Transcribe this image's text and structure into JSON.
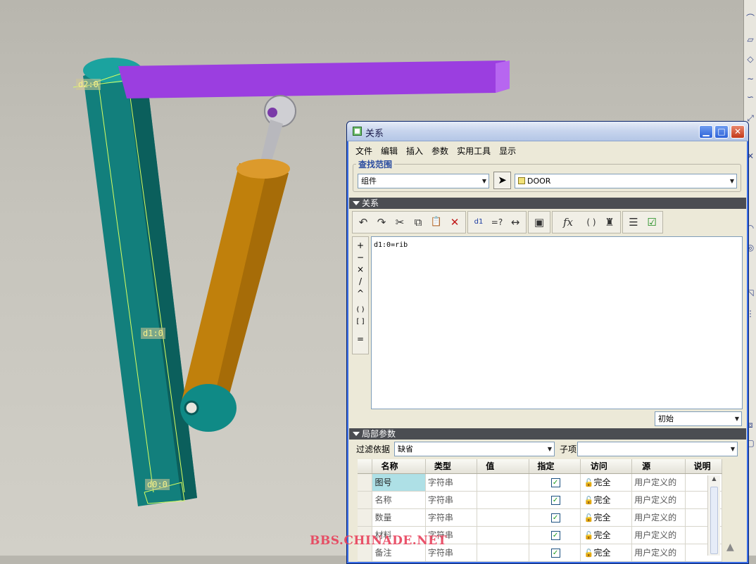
{
  "viewport": {
    "dim_top": "d2:0",
    "dim_mid": "d1:0",
    "dim_bottom": "d0:0"
  },
  "dialog": {
    "title": "关系",
    "window_buttons": {
      "minimize": "▁",
      "maximize": "□",
      "close": "✕"
    },
    "menu": [
      "文件",
      "编辑",
      "插入",
      "参数",
      "实用工具",
      "显示"
    ],
    "scope": {
      "legend": "查找范围",
      "type_value": "组件",
      "model_value": "DOOR"
    },
    "relations": {
      "header": "关系",
      "toolbar": [
        {
          "icon": "undo-icon",
          "glyph": "↶"
        },
        {
          "icon": "redo-icon",
          "glyph": "↷"
        },
        {
          "icon": "cut-icon",
          "glyph": "✂"
        },
        {
          "icon": "copy-icon",
          "glyph": "⧉"
        },
        {
          "icon": "paste-icon",
          "glyph": "📋"
        },
        {
          "icon": "delete-icon",
          "glyph": "✕"
        },
        {
          "icon": "show-values-icon",
          "glyph": "d1"
        },
        {
          "icon": "evaluate-icon",
          "glyph": "=?"
        },
        {
          "icon": "insert-dimension-icon",
          "glyph": "↔"
        },
        {
          "icon": "sort-relations-icon",
          "glyph": "▣"
        },
        {
          "icon": "function-icon",
          "glyph": "fx"
        },
        {
          "icon": "brackets-icon",
          "glyph": "( )"
        },
        {
          "icon": "unit-check-icon",
          "glyph": "♜"
        },
        {
          "icon": "check-list-icon",
          "glyph": "☰"
        },
        {
          "icon": "verify-icon",
          "glyph": "☑"
        }
      ],
      "operators": [
        "+",
        "−",
        "×",
        "/",
        "^",
        "( )",
        "[ ]",
        "="
      ],
      "text": "d1:0=rib",
      "initial_select": "初始"
    },
    "local_params": {
      "header": "局部参数",
      "filter_label": "过滤依据",
      "filter_value": "缺省",
      "child_label": "子项",
      "child_value": "",
      "columns": [
        "名称",
        "类型",
        "值",
        "指定",
        "访问",
        "源",
        "说明"
      ],
      "rows": [
        {
          "name": "图号",
          "type": "字符串",
          "value": "",
          "access": "完全",
          "source": "用户定义的",
          "desc": ""
        },
        {
          "name": "名称",
          "type": "字符串",
          "value": "",
          "access": "完全",
          "source": "用户定义的",
          "desc": ""
        },
        {
          "name": "数量",
          "type": "字符串",
          "value": "",
          "access": "完全",
          "source": "用户定义的",
          "desc": ""
        },
        {
          "name": "材料",
          "type": "字符串",
          "value": "",
          "access": "完全",
          "source": "用户定义的",
          "desc": ""
        },
        {
          "name": "备注",
          "type": "字符串",
          "value": "",
          "access": "完全",
          "source": "用户定义的",
          "desc": ""
        }
      ]
    }
  },
  "watermark": "BBS.CHINADE.NET",
  "colors": {
    "beam": "#9b3ee0",
    "plate": "#0f8a86",
    "cylinder": "#c8860a",
    "selected_cell": "#aee0e6"
  }
}
